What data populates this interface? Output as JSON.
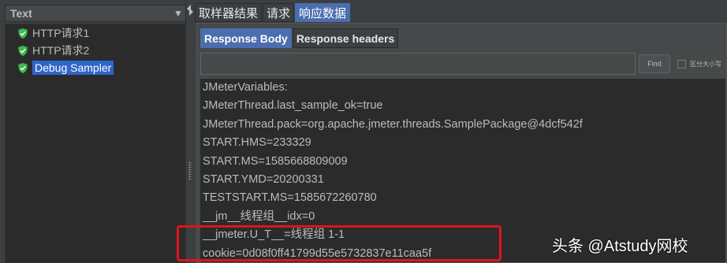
{
  "left_panel": {
    "header_title": "Text",
    "dropdown_icon": "chevron-down-icon",
    "tree_items": [
      {
        "label": "HTTP请求1",
        "icon": "shield-check-icon",
        "selected": false
      },
      {
        "label": "HTTP请求2",
        "icon": "shield-check-icon",
        "selected": false
      },
      {
        "label": "Debug Sampler",
        "icon": "shield-check-icon",
        "selected": true
      }
    ]
  },
  "top_tabs": [
    {
      "label": "取样器结果",
      "active": false
    },
    {
      "label": "请求",
      "active": false
    },
    {
      "label": "响应数据",
      "active": true
    }
  ],
  "sub_tabs": [
    {
      "label": "Response Body",
      "active": true
    },
    {
      "label": "Response headers",
      "active": false
    }
  ],
  "find_bar": {
    "value": "",
    "button_label": "Find",
    "case_sensitive_label": "区分大小写",
    "case_sensitive_checked": false
  },
  "response_lines": [
    "JMeterVariables:",
    "JMeterThread.last_sample_ok=true",
    "JMeterThread.pack=org.apache.jmeter.threads.SamplePackage@4dcf542f",
    "START.HMS=233329",
    "START.MS=1585668809009",
    "START.YMD=20200331",
    "TESTSTART.MS=1585672260780",
    "__jm__线程组__idx=0",
    "__jmeter.U_T__=线程组 1-1",
    "cookie=0d08f0ff41799d55e5732837e11caa5f"
  ],
  "watermark": "头条 @Atstudy网校",
  "colors": {
    "selection": "#2f65ca",
    "active_tab": "#4b6eaf",
    "highlight_border": "#e0141c",
    "shield_icon": "#3fb950"
  }
}
